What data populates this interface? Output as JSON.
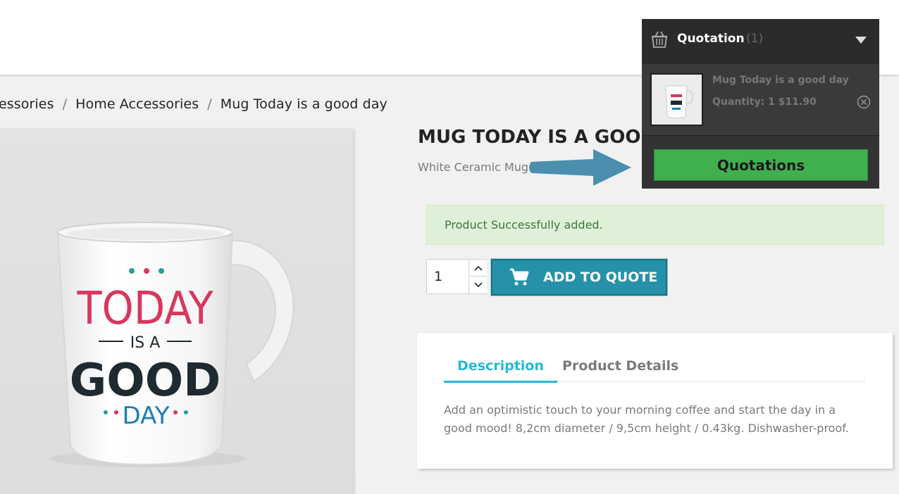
{
  "breadcrumb": {
    "items": [
      "essories",
      "Home Accessories",
      "Mug Today is a good day"
    ],
    "separator": "/"
  },
  "product": {
    "title": "MUG TODAY IS A GOOD",
    "short_description": "White Ceramic Mug.",
    "image_text": {
      "line1": "TODAY",
      "line2": "IS A",
      "line3": "GOOD",
      "line4": "DAY"
    }
  },
  "alert": {
    "message": "Product Successfully added."
  },
  "quantity": {
    "value": "1"
  },
  "add_to_quote": {
    "label": "ADD TO QUOTE"
  },
  "tabs": {
    "items": [
      {
        "label": "Description",
        "active": true
      },
      {
        "label": "Product Details",
        "active": false
      }
    ],
    "content": "Add an optimistic touch to your morning coffee and start the day in a good mood! 8,2cm diameter / 9,5cm height / 0.43kg. Dishwasher-proof."
  },
  "quotation_panel": {
    "title": "Quotation",
    "count": "(1)",
    "item": {
      "name": "Mug Today is a good day",
      "quantity_text": "Quantity: 1 $11.90"
    },
    "button_label": "Quotations"
  },
  "colors": {
    "accent": "#24b9d7",
    "add_button": "#2592a9",
    "quotations_button": "#40b04f",
    "alert_bg": "#dff0d8",
    "arrow": "#4a8fae"
  },
  "icons": [
    "basket-icon",
    "caret-down-icon",
    "remove-circle-icon",
    "cart-icon",
    "chevron-up-icon",
    "chevron-down-icon",
    "arrow-right-icon"
  ]
}
